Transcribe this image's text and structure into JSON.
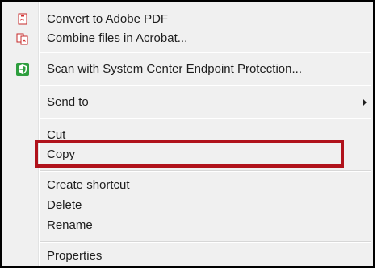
{
  "menu": {
    "items": [
      {
        "label": "Convert to Adobe PDF",
        "icon": "pdf-convert-icon"
      },
      {
        "label": "Combine files in Acrobat...",
        "icon": "acrobat-combine-icon"
      },
      {
        "label": "Scan with System Center Endpoint Protection...",
        "icon": "shield-scan-icon"
      },
      {
        "label": "Send to",
        "submenu": true
      },
      {
        "label": "Cut"
      },
      {
        "label": "Copy",
        "highlighted": true
      },
      {
        "label": "Create shortcut"
      },
      {
        "label": "Delete"
      },
      {
        "label": "Rename"
      },
      {
        "label": "Properties"
      }
    ]
  },
  "colors": {
    "highlight_border": "#b0121b",
    "menu_background": "#f0f0f0",
    "text": "#1e1e1e",
    "pdf_icon": "#d32f2f",
    "shield_icon": "#2e9e3e"
  }
}
